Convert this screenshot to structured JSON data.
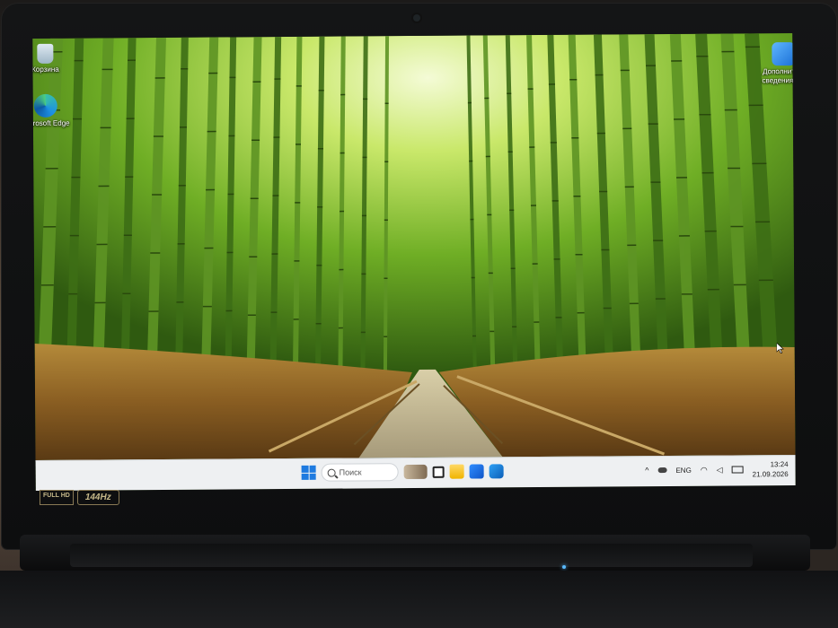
{
  "desktop": {
    "icons_left": [
      {
        "label": "Корзина",
        "icon": "recycle-bin-icon"
      },
      {
        "label": "Microsoft Edge",
        "icon": "edge-icon"
      }
    ],
    "icon_right": {
      "label": "Дополните... сведения о...",
      "icon": "photo-app-icon"
    }
  },
  "taskbar": {
    "search_placeholder": "Поиск",
    "pinned": [
      "start-icon",
      "search",
      "widgets-icon",
      "task-view-icon",
      "file-explorer-icon",
      "store-icon",
      "outlook-icon"
    ],
    "tray": {
      "language": "ENG",
      "time": "13:24",
      "date": "21.09.2026"
    }
  },
  "bezel": {
    "badge_full_hd": "FULL HD",
    "badge_hz": "144Hz"
  },
  "colors": {
    "taskbar_bg": "#eef0f2",
    "accent": "#1f7be0"
  }
}
